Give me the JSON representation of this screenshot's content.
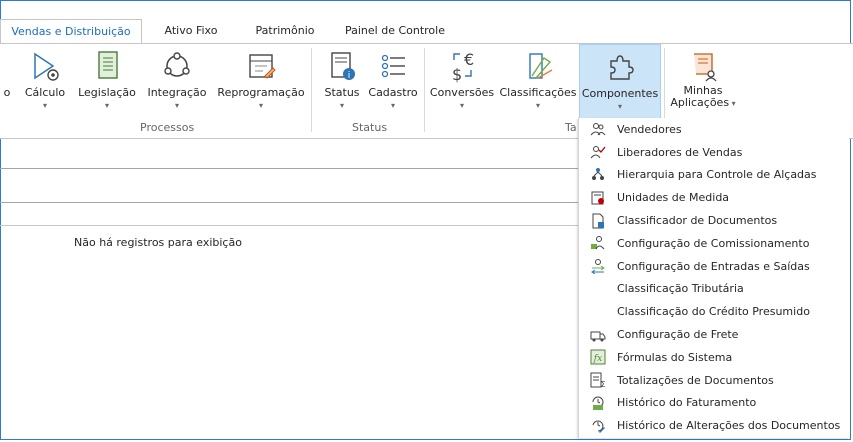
{
  "tabs": [
    {
      "label": "Vendas e Distribuição",
      "active": true
    },
    {
      "label": "Ativo Fixo",
      "active": false
    },
    {
      "label": "Patrimônio",
      "active": false
    },
    {
      "label": "Painel de Controle",
      "active": false
    }
  ],
  "ribbon": {
    "truncated_label": "o",
    "buttons": {
      "calculo": "Cálculo",
      "legislacao": "Legislação",
      "integracao": "Integração",
      "reprogramacao": "Reprogramação",
      "status": "Status",
      "cadastro": "Cadastro",
      "conversoes": "Conversões",
      "classificacoes": "Classificações",
      "componentes": "Componentes",
      "minhas_line1": "Minhas",
      "minhas_line2": "Aplicações"
    },
    "groups": {
      "processos": "Processos",
      "status": "Status",
      "tabelas_partial": "Ta"
    }
  },
  "grid": {
    "empty_message": "Não há registros para exibição"
  },
  "menu": {
    "items": [
      {
        "label": "Vendedores",
        "icon": "people-icon"
      },
      {
        "label": "Liberadores de Vendas",
        "icon": "people-check-icon"
      },
      {
        "label": "Hierarquia para Controle de Alçadas",
        "icon": "hierarchy-icon"
      },
      {
        "label": "Unidades de Medida",
        "icon": "ruler-icon"
      },
      {
        "label": "Classificador de Documentos",
        "icon": "document-classifier-icon"
      },
      {
        "label": "Configuração de Comissionamento",
        "icon": "commission-icon"
      },
      {
        "label": "Configuração de Entradas e Saídas",
        "icon": "in-out-icon"
      },
      {
        "label": "Classificação Tributária",
        "icon": ""
      },
      {
        "label": "Classificação do Crédito Presumido",
        "icon": ""
      },
      {
        "label": "Configuração de Frete",
        "icon": "freight-icon"
      },
      {
        "label": "Fórmulas do Sistema",
        "icon": "formula-icon"
      },
      {
        "label": "Totalizações de Documentos",
        "icon": "sum-icon"
      },
      {
        "label": "Histórico do Faturamento",
        "icon": "billing-history-icon"
      },
      {
        "label": "Histórico de Alterações dos Documentos",
        "icon": "change-history-icon"
      }
    ]
  },
  "colors": {
    "accent": "#1e6dbf",
    "highlight": "#cce4f7",
    "border": "#2b7cd3"
  }
}
